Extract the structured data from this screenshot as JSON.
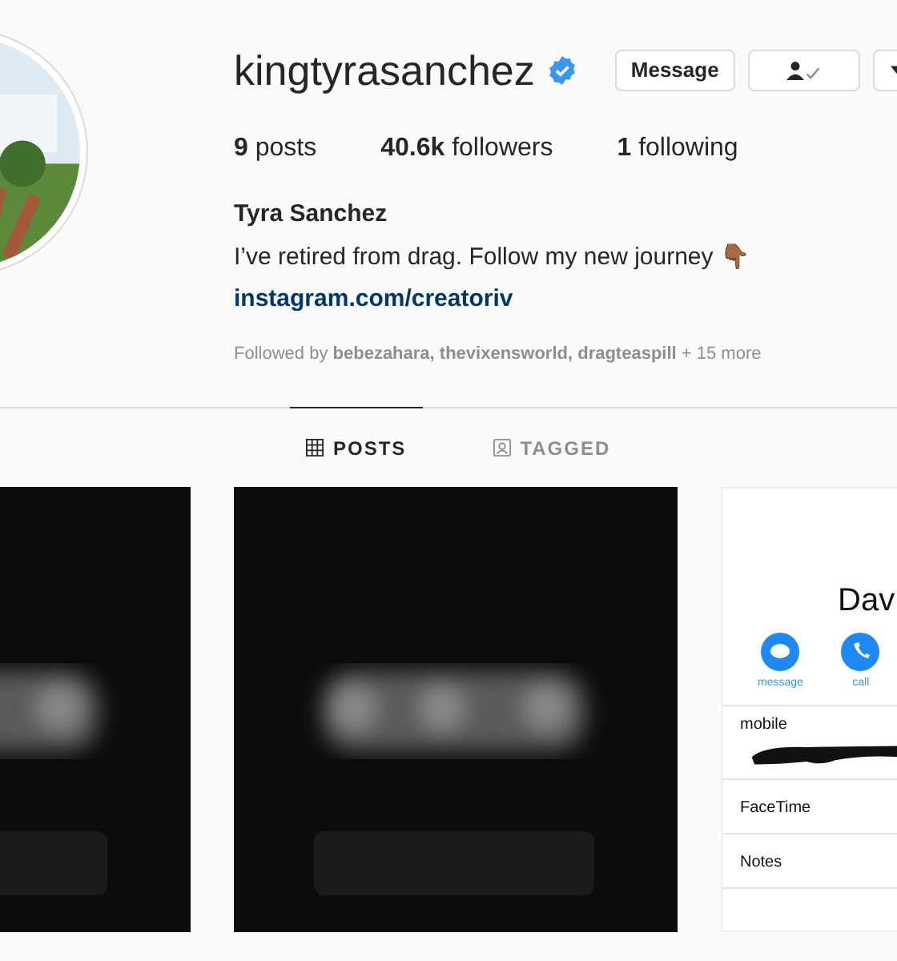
{
  "profile": {
    "username": "kingtyrasanchez",
    "verified": true,
    "buttons": [
      {
        "kind": "text",
        "label": "Message"
      },
      {
        "kind": "following"
      },
      {
        "kind": "dropdown"
      }
    ],
    "stats": [
      "**9** posts",
      "**40.6k** followers",
      "**1** following"
    ],
    "name": "Tyra Sanchez",
    "bio": "I’ve retired from drag. Follow my new journey 👇🏾",
    "link": "instagram.com/creatoriv",
    "followed_by": "Followed by **bebezahara, thevixensworld, dragteaspill** + 15 more"
  },
  "tabs": [
    {
      "kind": "grid",
      "label": "POSTS",
      "selected": true
    },
    {
      "kind": "tagged",
      "label": "TAGGED",
      "selected": false
    }
  ],
  "posts": [
    {
      "kind": "picture"
    },
    {
      "kind": "picture"
    },
    {
      "kind": "contact",
      "name": "Dav",
      "actions": [
        {
          "kind": "message",
          "label": "message"
        },
        {
          "kind": "call",
          "label": "call"
        }
      ],
      "fields": [
        {
          "kind": "scribbled",
          "label": "mobile"
        },
        {
          "kind": "plain",
          "label": "FaceTime"
        },
        {
          "kind": "plain",
          "label": "Notes"
        }
      ]
    }
  ]
}
